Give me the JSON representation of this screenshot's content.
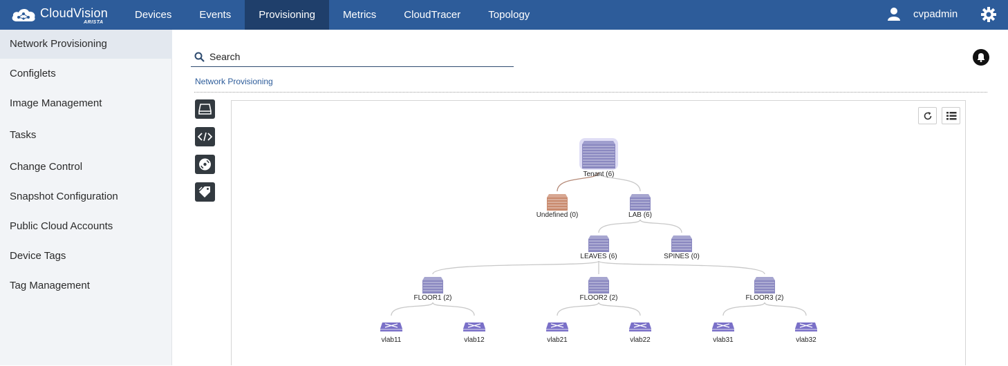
{
  "header": {
    "logo": {
      "name": "CloudVision",
      "sub": "ARISTA"
    },
    "nav": [
      "Devices",
      "Events",
      "Provisioning",
      "Metrics",
      "CloudTracer",
      "Topology"
    ],
    "active_nav": "Provisioning",
    "user": "cvpadmin"
  },
  "sidebar": {
    "items": [
      {
        "label": "Network Provisioning",
        "active": true
      },
      {
        "label": "Configlets"
      },
      {
        "label": "Image Management"
      },
      {
        "label": "Tasks"
      },
      {
        "label": "Change Control"
      },
      {
        "label": "Snapshot Configuration"
      },
      {
        "label": "Public Cloud Accounts"
      },
      {
        "label": "Device Tags"
      },
      {
        "label": "Tag Management"
      }
    ]
  },
  "main": {
    "search_placeholder": "Search",
    "breadcrumb": "Network Provisioning",
    "toolbar": [
      "device-icon",
      "code-icon",
      "image-disc-icon",
      "tags-icon"
    ],
    "canvas_buttons": [
      "refresh-icon",
      "list-view-icon"
    ]
  },
  "tree": {
    "colors": {
      "container": "#8a88c0",
      "undefined": "#c98a6e",
      "switch": "#7a70c8",
      "edge": "#c8c8c8",
      "edge_undefined": "#b58a78"
    },
    "nodes": [
      {
        "id": "tenant",
        "label": "Tenant (6)",
        "kind": "root",
        "parent": null
      },
      {
        "id": "undefined",
        "label": "Undefined (0)",
        "kind": "undefined",
        "parent": "tenant"
      },
      {
        "id": "lab",
        "label": "LAB (6)",
        "kind": "container",
        "parent": "tenant"
      },
      {
        "id": "leaves",
        "label": "LEAVES (6)",
        "kind": "container",
        "parent": "lab"
      },
      {
        "id": "spines",
        "label": "SPINES (0)",
        "kind": "container",
        "parent": "lab"
      },
      {
        "id": "floor1",
        "label": "FLOOR1 (2)",
        "kind": "container",
        "parent": "leaves"
      },
      {
        "id": "floor2",
        "label": "FLOOR2 (2)",
        "kind": "container",
        "parent": "leaves"
      },
      {
        "id": "floor3",
        "label": "FLOOR3 (2)",
        "kind": "container",
        "parent": "leaves"
      },
      {
        "id": "vlab11",
        "label": "vlab11",
        "kind": "switch",
        "parent": "floor1"
      },
      {
        "id": "vlab12",
        "label": "vlab12",
        "kind": "switch",
        "parent": "floor1"
      },
      {
        "id": "vlab21",
        "label": "vlab21",
        "kind": "switch",
        "parent": "floor2"
      },
      {
        "id": "vlab22",
        "label": "vlab22",
        "kind": "switch",
        "parent": "floor2"
      },
      {
        "id": "vlab31",
        "label": "vlab31",
        "kind": "switch",
        "parent": "floor3"
      },
      {
        "id": "vlab32",
        "label": "vlab32",
        "kind": "switch",
        "parent": "floor3"
      }
    ]
  }
}
